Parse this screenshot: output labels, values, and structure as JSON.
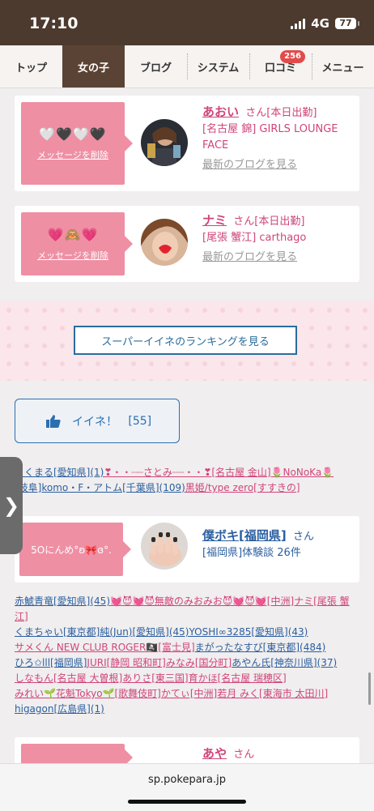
{
  "status": {
    "time": "17:10",
    "network": "4G",
    "battery": "77"
  },
  "nav": {
    "tabs": [
      {
        "label": "トップ"
      },
      {
        "label": "女の子"
      },
      {
        "label": "ブログ"
      },
      {
        "label": "システム"
      },
      {
        "label": "口コミ",
        "badge": "256"
      },
      {
        "label": "メニュー"
      }
    ],
    "active_index": 1
  },
  "cards": [
    {
      "emoji": "🤍🖤🤍🖤",
      "delete_label": "メッセージを削除",
      "name": "あおい",
      "san": "さん",
      "status": "[本日出勤]",
      "location": "[名古屋 錦] GIRLS LOUNGE FACE",
      "blog_link": "最新のブログを見る"
    },
    {
      "emoji": "💗🙈💗",
      "delete_label": "メッセージを削除",
      "name": "ナミ",
      "san": "さん",
      "status": "[本日出勤]",
      "location": "[尾張 蟹江] carthago",
      "blog_link": "最新のブログを見る"
    }
  ],
  "ranking_button": "スーパーイイネのランキングを見る",
  "like": {
    "label": "イイネ！",
    "count": "[55]"
  },
  "list1": {
    "line1_a": "ぐくまる[愛知県](1)",
    "line1_b": "❣・・┈┈さとみ┈┈・・❣",
    "line1_c": "[名古屋 金山]",
    "line1_d": "🌷NoNoKa🌷",
    "line2_a": "[岐阜]komo・F・アトム[千葉県](109)",
    "line2_b": "黒姫/type zero[すすきの]"
  },
  "reviewer": {
    "emoji_text": "5Oにんめ°ʚ🎀ɞ°.",
    "name": "僕ボキ[福岡県]",
    "san": "さん",
    "detail": "[福岡県]体験談 26件"
  },
  "list2": {
    "l1a": "赤鯱青竜[愛知県](45)",
    "l1b": "💓😈💓😈無敵のみおみお😈💓😈💓[中洲]ナミ[尾張 蟹江]",
    "l2a": "くまちゃい[東京都]",
    "l2b": "純(Jun)[愛知県](45)",
    "l2c": "YOSHI∞3285[愛知県](43)",
    "l3a": "サメくん NEW CLUB ROGER🏴‍☠️[富士見]",
    "l3b": "まがったなすび[東京都](484)",
    "l3c": "ひろ✩lll[福岡県]",
    "l4a": "JURI[静岡 昭和町]",
    "l4b": "みなみ[国分町]",
    "l4c": "あやん氏[神奈川県](37)",
    "l5a": "しなもん[名古屋 大曽根]",
    "l5b": "ありさ[東三国]",
    "l5c": "育かほ[名古屋 瑞穂区]",
    "l5d": "みれい🌱花魁Tokyo🌱[歌舞伎町]",
    "l6a": "かてぃ[中洲]",
    "l6b": "若月 みく[東海市 太田川]",
    "l6c": "higagon[広島県](1)"
  },
  "card3": {
    "name": "あや",
    "san": "さん"
  },
  "url": "sp.pokepara.jp"
}
